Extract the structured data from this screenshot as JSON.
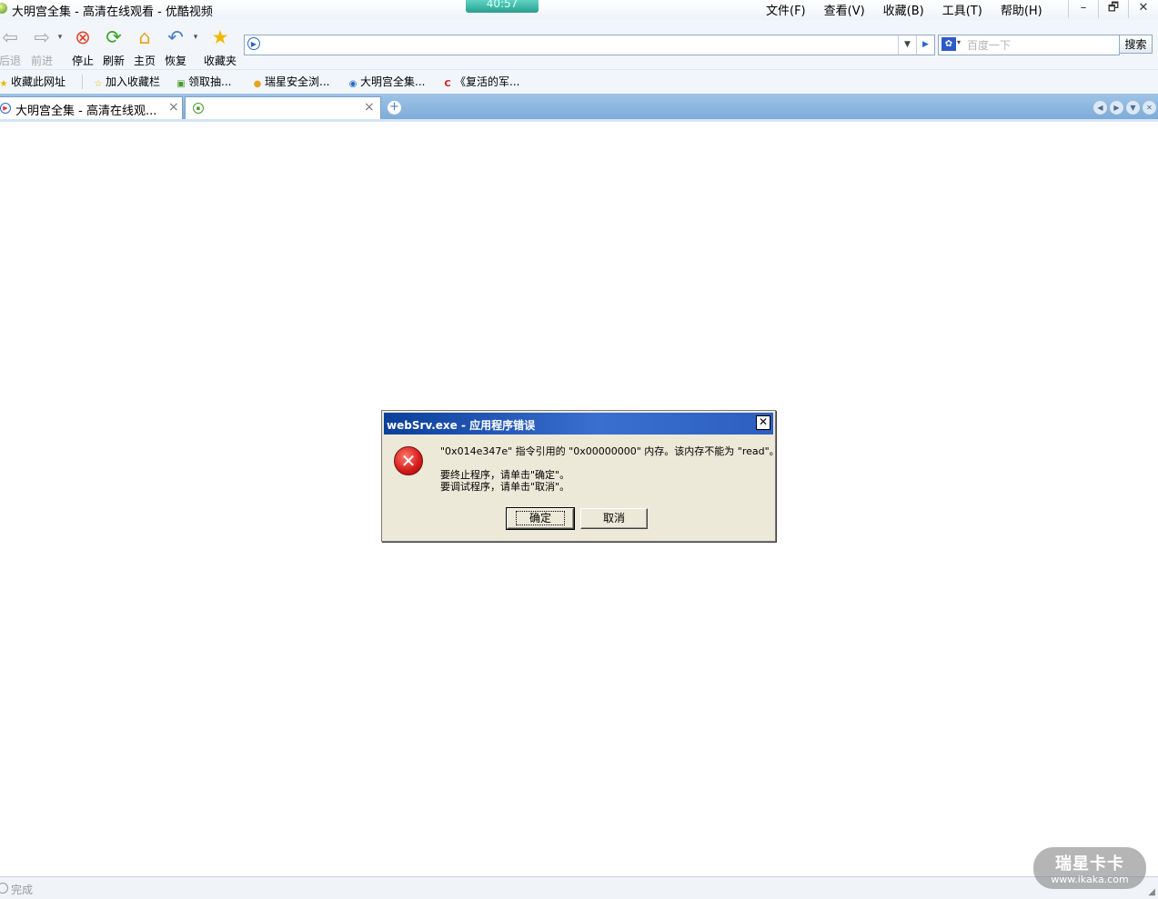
{
  "window": {
    "title": "大明宫全集 - 高清在线观看 - 优酷视频",
    "clock": "40:57",
    "menu": [
      "文件(F)",
      "查看(V)",
      "收藏(B)",
      "工具(T)",
      "帮助(H)"
    ],
    "controls": {
      "minimize": "–",
      "restore": "🗗",
      "close": "✕"
    }
  },
  "toolbar": {
    "back": "后退",
    "forward": "前进",
    "stop": "停止",
    "refresh": "刷新",
    "home": "主页",
    "restore": "恢复",
    "favorites": "收藏夹",
    "address_value": "",
    "search_placeholder": "百度一下",
    "search_button": "搜索"
  },
  "favbar": {
    "items": [
      "收藏此网址",
      "加入收藏栏",
      "领取抽...",
      "瑞星安全浏...",
      "大明宫全集...",
      "《复活的军..."
    ]
  },
  "tabs": [
    {
      "label": "大明宫全集 - 高清在线观..."
    },
    {
      "label": ""
    }
  ],
  "dialog": {
    "title": "webSrv.exe - 应用程序错误",
    "message": "\"0x014e347e\" 指令引用的 \"0x00000000\" 内存。该内存不能为 \"read\"。",
    "line2": "要终止程序，请单击\"确定\"。",
    "line3": "要调试程序，请单击\"取消\"。",
    "ok": "确定",
    "cancel": "取消",
    "close": "✕"
  },
  "status": {
    "text": "完成"
  },
  "watermark": {
    "line1": "瑞星卡卡",
    "line2": "www.ikaka.com"
  },
  "colors": {
    "dialog_title_start": "#0a3f9a",
    "dialog_title_end": "#3a6fd0",
    "dialog_bg": "#ece9d8",
    "tabbar": "#7eacd9",
    "error_icon": "#d31a1a"
  }
}
